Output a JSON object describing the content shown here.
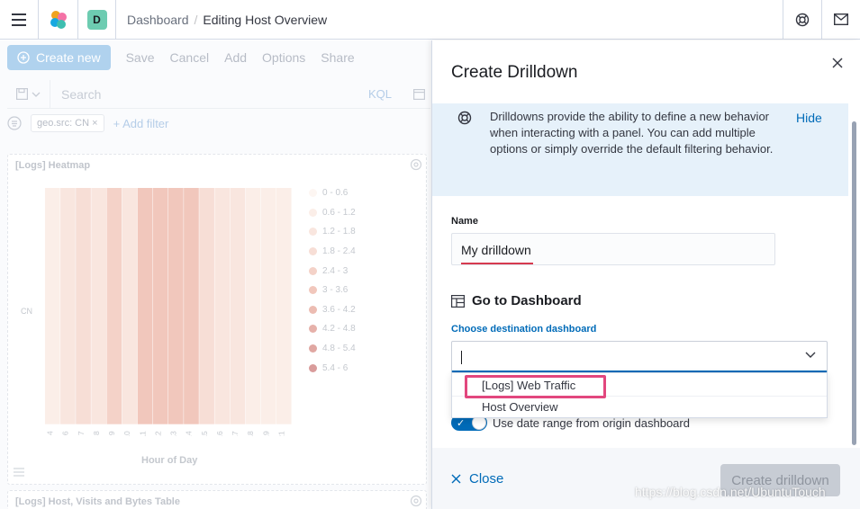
{
  "header": {
    "menu_icon": "hamburger-menu-icon",
    "logo_icon": "kibana-logo-icon",
    "space_badge": "D",
    "breadcrumb_dashboard": "Dashboard",
    "breadcrumb_separator": "/",
    "breadcrumb_current": "Editing Host Overview",
    "help_icon": "help-lifebuoy-icon",
    "mail_icon": "newsfeed-mail-icon"
  },
  "dashboard": {
    "create_new": "Create new",
    "links": [
      "Save",
      "Cancel",
      "Add",
      "Options",
      "Share"
    ],
    "search_placeholder": "Search",
    "kql": "KQL",
    "filter_pill": "geo.src: CN",
    "add_filter": "+ Add filter",
    "heatmap_title": "[Logs] Heatmap",
    "y_category": "CN",
    "x_title": "Hour of Day",
    "x_ticks": [
      "4",
      "6",
      "7",
      "8",
      "9",
      "10",
      "11",
      "12",
      "13",
      "14",
      "15",
      "16",
      "17",
      "18",
      "19",
      "21"
    ],
    "legend": [
      "0 - 0.6",
      "0.6 - 1.2",
      "1.2 - 1.8",
      "1.8 - 2.4",
      "2.4 - 3",
      "3 - 3.6",
      "3.6 - 4.2",
      "4.2 - 4.8",
      "4.8 - 5.4",
      "5.4 - 6"
    ],
    "table_title": "[Logs] Host, Visits and Bytes Table"
  },
  "chart_data": {
    "type": "heatmap",
    "title": "[Logs] Heatmap",
    "xlabel": "Hour of Day",
    "ylabel": "",
    "y_categories": [
      "CN"
    ],
    "x_categories": [
      "4",
      "6",
      "7",
      "8",
      "9",
      "10",
      "11",
      "12",
      "13",
      "14",
      "15",
      "16",
      "17",
      "18",
      "19",
      "21"
    ],
    "values": [
      [
        1,
        2,
        3,
        2,
        4,
        2,
        5,
        5,
        5,
        5,
        3,
        2,
        2,
        1,
        1,
        1
      ]
    ],
    "legend_ranges": [
      "0 - 0.6",
      "0.6 - 1.2",
      "1.2 - 1.8",
      "1.8 - 2.4",
      "2.4 - 3",
      "3 - 3.6",
      "3.6 - 4.2",
      "4.2 - 4.8",
      "4.8 - 5.4",
      "5.4 - 6"
    ],
    "legend_colors": [
      "#fdf6f2",
      "#fbeee8",
      "#f9e6df",
      "#f7ded6",
      "#f4d2c8",
      "#f1c7bc",
      "#ecbcb2",
      "#e6b1aa",
      "#e0a7a2",
      "#d99c9b"
    ]
  },
  "flyout": {
    "title": "Create Drilldown",
    "close_icon": "cross-icon",
    "callout_icon": "help-lifebuoy-icon",
    "callout_text": "Drilldowns provide the ability to define a new behavior when interacting with a panel. You can add multiple options or simply override the default filtering behavior.",
    "callout_hide": "Hide",
    "name_label": "Name",
    "name_value": "My drilldown",
    "section_icon": "dashboard-app-icon",
    "section_title": "Go to Dashboard",
    "dest_label": "Choose destination dashboard",
    "dest_value": "",
    "options": [
      "[Logs] Web Traffic",
      "Host Overview"
    ],
    "toggle_label": "Use date range from origin dashboard",
    "toggle_on": true,
    "close_label": "Close",
    "create_label": "Create drilldown"
  },
  "watermark": "https://blog.csdn.net/UbuntuTouch"
}
